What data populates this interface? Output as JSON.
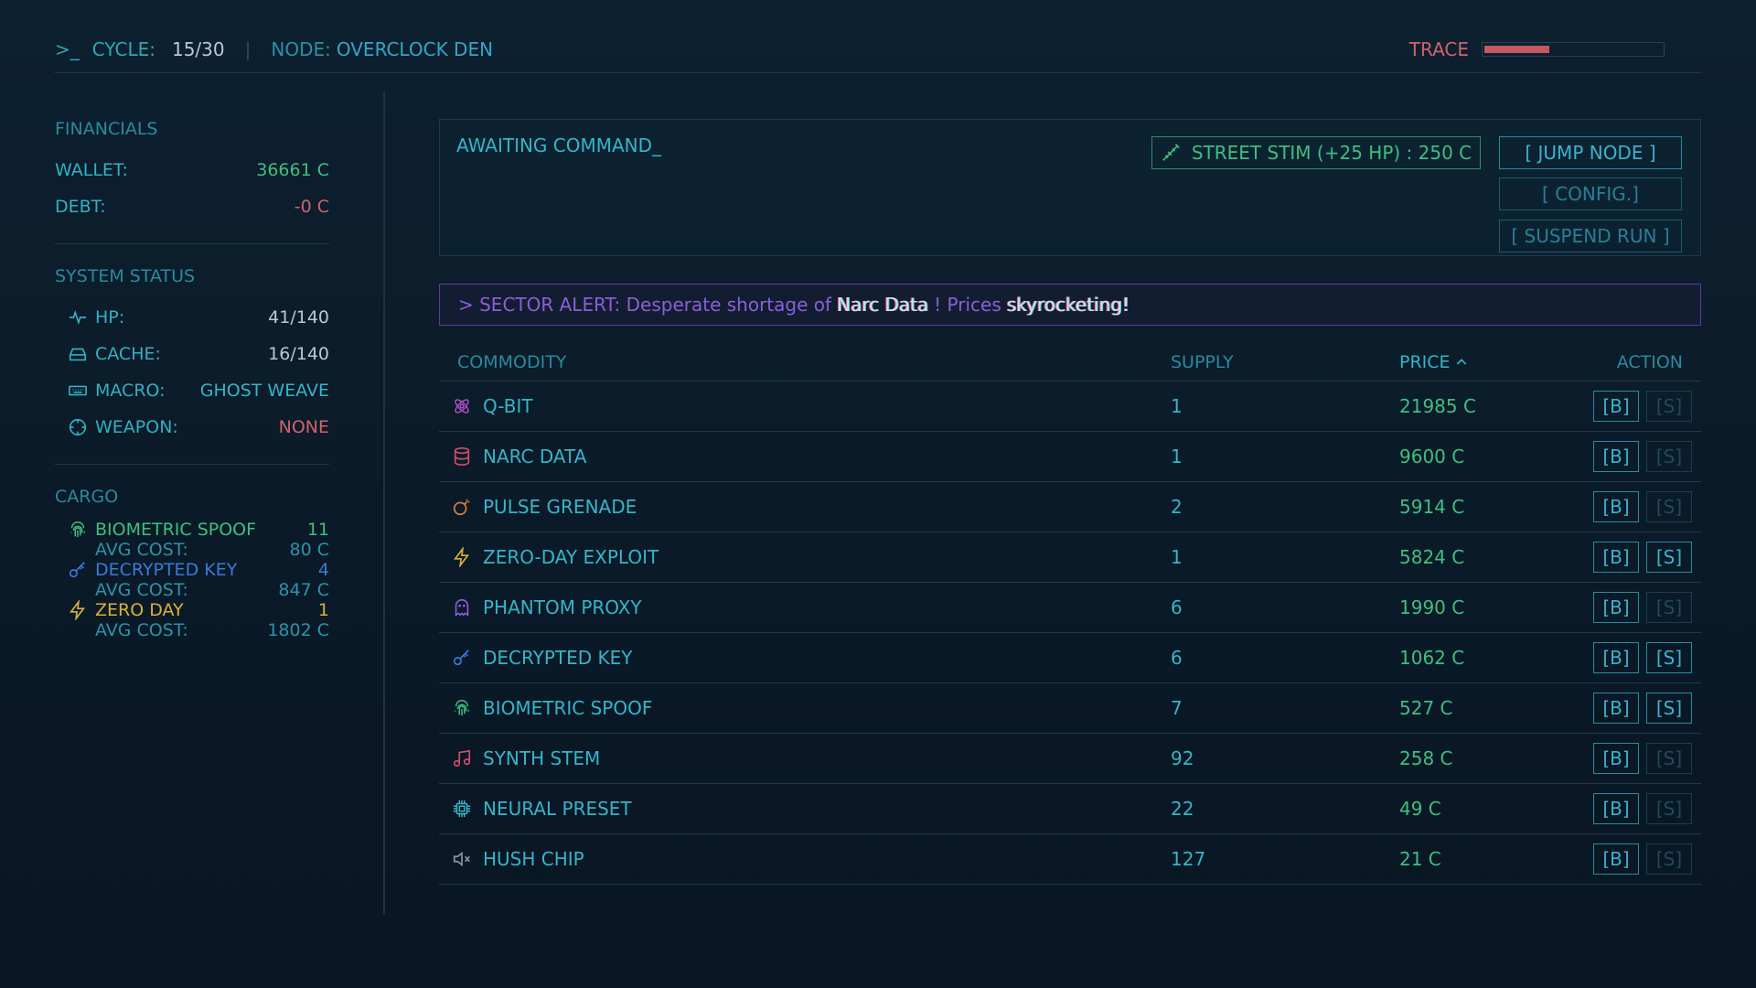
{
  "topbar": {
    "prompt": ">_",
    "cycle_label": "CYCLE:",
    "cycle_value": "15/30",
    "separator": "|",
    "node_label": "NODE:",
    "node_value": "OVERCLOCK DEN",
    "trace_label": "TRACE",
    "trace_level": 0.36
  },
  "financials": {
    "title": "FINANCIALS",
    "wallet_label": "WALLET:",
    "wallet_value": "36661 C",
    "debt_label": "DEBT:",
    "debt_value": "-0 C"
  },
  "system_status": {
    "title": "SYSTEM STATUS",
    "hp_label": "HP:",
    "hp_value": "41/140",
    "cache_label": "CACHE:",
    "cache_value": "16/140",
    "macro_label": "MACRO:",
    "macro_value": "GHOST WEAVE",
    "weapon_label": "WEAPON:",
    "weapon_value": "NONE"
  },
  "cargo": {
    "title": "CARGO",
    "avg_label": "AVG COST:",
    "items": [
      {
        "name": "BIOMETRIC SPOOF",
        "qty": "11",
        "avg": "80 C",
        "color": "#3fbf7f",
        "icon": "fingerprint-icon"
      },
      {
        "name": "DECRYPTED KEY",
        "qty": "4",
        "avg": "847 C",
        "color": "#3a7ad8",
        "icon": "key-icon"
      },
      {
        "name": "ZERO DAY",
        "qty": "1",
        "avg": "1802 C",
        "color": "#d8b23a",
        "icon": "bolt-icon"
      }
    ]
  },
  "command": {
    "status": "AWAITING COMMAND_",
    "stim_label": "STREET STIM (+25 HP) : 250 C",
    "jump_label": "[ JUMP NODE ]",
    "config_label": "[ CONFIG.]",
    "suspend_label": "[ SUSPEND RUN ]"
  },
  "alert": {
    "prefix": "> SECTOR ALERT: Desperate shortage of",
    "item": "Narc Data",
    "mid": "! Prices",
    "end": "skyrocketing!"
  },
  "market": {
    "headers": {
      "commodity": "COMMODITY",
      "supply": "SUPPLY",
      "price": "PRICE",
      "action": "ACTION"
    },
    "buy_label": "[B]",
    "sell_label": "[S]",
    "rows": [
      {
        "name": "Q-BIT",
        "supply": "1",
        "price": "21985 C",
        "icon": "atom-icon",
        "iconColor": "#b04fc8",
        "sell": false
      },
      {
        "name": "NARC DATA",
        "supply": "1",
        "price": "9600 C",
        "icon": "database-icon",
        "iconColor": "#d0506a",
        "sell": false
      },
      {
        "name": "PULSE GRENADE",
        "supply": "2",
        "price": "5914 C",
        "icon": "bomb-icon",
        "iconColor": "#e0803a",
        "sell": false
      },
      {
        "name": "ZERO-DAY EXPLOIT",
        "supply": "1",
        "price": "5824 C",
        "icon": "bolt-icon",
        "iconColor": "#d8b23a",
        "sell": true
      },
      {
        "name": "PHANTOM PROXY",
        "supply": "6",
        "price": "1990 C",
        "icon": "ghost-icon",
        "iconColor": "#8b5fd6",
        "sell": false
      },
      {
        "name": "DECRYPTED KEY",
        "supply": "6",
        "price": "1062 C",
        "icon": "key-icon",
        "iconColor": "#3a7ad8",
        "sell": true
      },
      {
        "name": "BIOMETRIC SPOOF",
        "supply": "7",
        "price": "527 C",
        "icon": "fingerprint-icon",
        "iconColor": "#3fbf7f",
        "sell": true
      },
      {
        "name": "SYNTH STEM",
        "supply": "92",
        "price": "258 C",
        "icon": "music-icon",
        "iconColor": "#d0506a",
        "sell": false
      },
      {
        "name": "NEURAL PRESET",
        "supply": "22",
        "price": "49 C",
        "icon": "chip-icon",
        "iconColor": "#35b5c8",
        "sell": false
      },
      {
        "name": "HUSH CHIP",
        "supply": "127",
        "price": "21 C",
        "icon": "mute-icon",
        "iconColor": "#8a99a8",
        "sell": false
      }
    ]
  }
}
